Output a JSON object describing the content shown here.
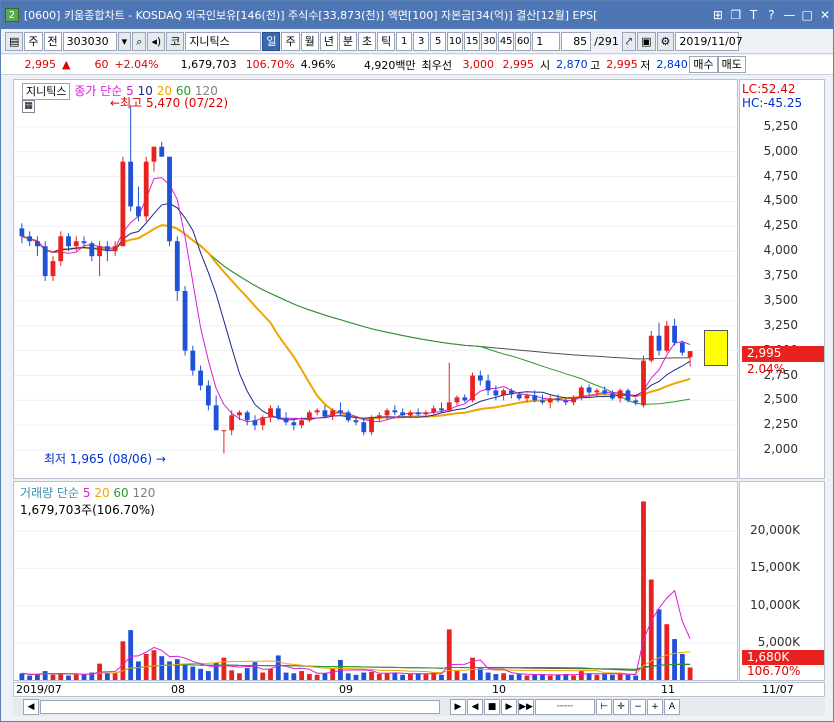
{
  "window": {
    "icon": "2",
    "title": "[0600] 키움종합차트 - KOSDAQ 외국인보유[146(천)] 주식수[33,873(천)] 액면[100] 자본금[34(억)] 결산[12월] EPS[",
    "controls": [
      "tile-icon",
      "restore-icon",
      "font-icon",
      "question-icon",
      "minimize-icon",
      "maximize-icon",
      "close-icon"
    ]
  },
  "toolbar": {
    "mode": "주",
    "period_select": "전",
    "code": "303030",
    "market": "코",
    "name": "지니틱스",
    "periods": [
      "일",
      "주",
      "월",
      "년",
      "분",
      "초",
      "틱"
    ],
    "active_period": "일",
    "minutes": [
      "1",
      "3",
      "5",
      "10",
      "15",
      "30",
      "45",
      "60"
    ],
    "count": "1",
    "page": "85",
    "total": "/291",
    "date": "2019/11/07"
  },
  "quote": {
    "price": "2,995",
    "change_arrow": "▲",
    "change": "60",
    "change_pct": "+2.04%",
    "volume": "1,679,703",
    "vol_ratio": "106.70%",
    "turnover": "4.96%",
    "amount": "4,920백만",
    "best_label": "최우선",
    "best_ask": "3,000",
    "best_bid": "2,995",
    "open_label": "시",
    "open": "2,870",
    "high_label": "고",
    "high": "2,995",
    "low_label": "저",
    "low": "2,840",
    "buy_label": "매수",
    "sell_label": "매도"
  },
  "price_panel": {
    "name_tag": "지니틱스",
    "legend_label": "종가 단순",
    "ma_periods": [
      "5",
      "10",
      "20",
      "60",
      "120"
    ],
    "high_note": "최고 5,470 (07/22)",
    "low_note": "최저 1,965 (08/06)",
    "lc": "LC:52.42",
    "hc": "HC:-45.25",
    "current_price": "2,995",
    "current_pct": "2.04%"
  },
  "volume_panel": {
    "legend_label": "거래량 단순",
    "ma_periods": [
      "5",
      "20",
      "60",
      "120"
    ],
    "current_volume": "1,679,703주(106.70%)",
    "current_tag": "1,680K",
    "current_pct": "106.70%"
  },
  "x_axis": {
    "labels": [
      "2019/07",
      "08",
      "09",
      "10",
      "11"
    ],
    "end_date": "11/07"
  },
  "colors": {
    "up": "#e8231f",
    "down": "#1f52d6",
    "ma5": "#d81fd8",
    "ma10": "#1a2a8a",
    "ma20": "#f0a400",
    "ma60": "#2a9a2a",
    "ma120": "#505050"
  },
  "chart_data": [
    {
      "type": "candlestick",
      "title": "지니틱스",
      "ylim": [
        1800,
        5500
      ],
      "yticks": [
        2000,
        2250,
        2500,
        2750,
        3000,
        3250,
        3500,
        3750,
        4000,
        4250,
        4500,
        4750,
        5000,
        5250
      ],
      "ytick_labels": [
        "2,000",
        "2,250",
        "2,500",
        "2,750",
        "3,000",
        "3,250",
        "3,500",
        "3,750",
        "4,000",
        "4,250",
        "4,500",
        "4,750",
        "5,000",
        "5,250"
      ],
      "ohlc": [
        [
          4230,
          4280,
          4080,
          4150
        ],
        [
          4150,
          4200,
          4050,
          4100
        ],
        [
          4100,
          4150,
          3950,
          4050
        ],
        [
          4050,
          4100,
          3700,
          3750
        ],
        [
          3750,
          3950,
          3700,
          3900
        ],
        [
          3900,
          4200,
          3850,
          4150
        ],
        [
          4150,
          4180,
          4000,
          4050
        ],
        [
          4050,
          4150,
          4000,
          4100
        ],
        [
          4100,
          4150,
          4050,
          4080
        ],
        [
          4080,
          4100,
          3900,
          3950
        ],
        [
          3950,
          4100,
          3750,
          4050
        ],
        [
          4050,
          4100,
          3900,
          4000
        ],
        [
          4000,
          4100,
          3950,
          4050
        ],
        [
          4050,
          4950,
          4050,
          4900
        ],
        [
          4900,
          5470,
          4400,
          4450
        ],
        [
          4450,
          4650,
          4300,
          4350
        ],
        [
          4350,
          4950,
          4300,
          4900
        ],
        [
          4900,
          5050,
          4800,
          5050
        ],
        [
          5050,
          5100,
          4950,
          4950
        ],
        [
          4950,
          4550,
          4050,
          4100
        ],
        [
          4100,
          4150,
          3500,
          3600
        ],
        [
          3600,
          3650,
          2950,
          3000
        ],
        [
          3000,
          3050,
          2750,
          2800
        ],
        [
          2800,
          2850,
          2600,
          2650
        ],
        [
          2650,
          2700,
          2400,
          2450
        ],
        [
          2450,
          2550,
          2200,
          2200
        ],
        [
          2200,
          2200,
          1965,
          2200
        ],
        [
          2200,
          2400,
          2150,
          2350
        ],
        [
          2350,
          2400,
          2300,
          2380
        ],
        [
          2380,
          2400,
          2250,
          2300
        ],
        [
          2300,
          2350,
          2200,
          2250
        ],
        [
          2250,
          2350,
          2200,
          2330
        ],
        [
          2330,
          2450,
          2280,
          2420
        ],
        [
          2420,
          2450,
          2300,
          2320
        ],
        [
          2320,
          2380,
          2250,
          2280
        ],
        [
          2280,
          2320,
          2200,
          2250
        ],
        [
          2250,
          2330,
          2220,
          2300
        ],
        [
          2300,
          2400,
          2280,
          2380
        ],
        [
          2380,
          2420,
          2350,
          2400
        ],
        [
          2400,
          2450,
          2320,
          2340
        ],
        [
          2340,
          2420,
          2300,
          2400
        ],
        [
          2400,
          2480,
          2350,
          2380
        ],
        [
          2380,
          2400,
          2280,
          2300
        ],
        [
          2300,
          2330,
          2250,
          2280
        ],
        [
          2280,
          2320,
          2150,
          2180
        ],
        [
          2180,
          2350,
          2150,
          2320
        ],
        [
          2320,
          2380,
          2280,
          2350
        ],
        [
          2350,
          2420,
          2300,
          2400
        ],
        [
          2400,
          2450,
          2350,
          2380
        ],
        [
          2380,
          2420,
          2330,
          2350
        ],
        [
          2350,
          2400,
          2320,
          2380
        ],
        [
          2380,
          2420,
          2340,
          2360
        ],
        [
          2360,
          2400,
          2330,
          2380
        ],
        [
          2380,
          2450,
          2350,
          2420
        ],
        [
          2420,
          2480,
          2380,
          2400
        ],
        [
          2400,
          2880,
          2380,
          2480
        ],
        [
          2480,
          2550,
          2450,
          2530
        ],
        [
          2530,
          2560,
          2480,
          2500
        ],
        [
          2500,
          2780,
          2480,
          2750
        ],
        [
          2750,
          2800,
          2650,
          2700
        ],
        [
          2700,
          2760,
          2550,
          2600
        ],
        [
          2600,
          2650,
          2500,
          2550
        ],
        [
          2550,
          2620,
          2500,
          2600
        ],
        [
          2600,
          2620,
          2520,
          2560
        ],
        [
          2560,
          2580,
          2500,
          2520
        ],
        [
          2520,
          2570,
          2480,
          2550
        ],
        [
          2550,
          2600,
          2480,
          2500
        ],
        [
          2500,
          2560,
          2460,
          2480
        ],
        [
          2480,
          2550,
          2420,
          2520
        ],
        [
          2520,
          2560,
          2480,
          2500
        ],
        [
          2500,
          2530,
          2450,
          2480
        ],
        [
          2480,
          2550,
          2450,
          2530
        ],
        [
          2530,
          2650,
          2500,
          2630
        ],
        [
          2630,
          2660,
          2550,
          2580
        ],
        [
          2580,
          2620,
          2540,
          2600
        ],
        [
          2600,
          2640,
          2550,
          2570
        ],
        [
          2570,
          2600,
          2500,
          2520
        ],
        [
          2520,
          2620,
          2480,
          2600
        ],
        [
          2600,
          2620,
          2480,
          2500
        ],
        [
          2500,
          2520,
          2450,
          2480
        ],
        [
          2450,
          2950,
          2430,
          2900
        ],
        [
          2900,
          3200,
          2880,
          3150
        ],
        [
          3150,
          3280,
          2950,
          3000
        ],
        [
          3000,
          3300,
          2980,
          3250
        ],
        [
          3250,
          3320,
          3050,
          3080
        ],
        [
          3080,
          3100,
          2950,
          2980
        ],
        [
          2935,
          2995,
          2840,
          2995
        ]
      ]
    },
    {
      "type": "bar",
      "title": "거래량",
      "ylim": [
        0,
        25000
      ],
      "yticks": [
        5000,
        10000,
        15000,
        20000
      ],
      "ytick_labels": [
        "5,000K",
        "10,000K",
        "15,000K",
        "20,000K"
      ],
      "values_k": [
        900,
        600,
        800,
        1200,
        700,
        900,
        600,
        800,
        700,
        1000,
        2200,
        900,
        900,
        5200,
        6700,
        2500,
        3500,
        4000,
        3200,
        2500,
        2800,
        2200,
        1800,
        1500,
        1200,
        2300,
        3000,
        1300,
        900,
        1600,
        2400,
        1000,
        1500,
        3300,
        1000,
        900,
        1200,
        800,
        700,
        900,
        1500,
        2700,
        900,
        700,
        1000,
        1100,
        800,
        900,
        1000,
        700,
        800,
        900,
        800,
        1000,
        700,
        6800,
        1200,
        900,
        3000,
        1600,
        1000,
        800,
        900,
        700,
        800,
        600,
        700,
        800,
        600,
        700,
        800,
        600,
        1200,
        900,
        700,
        800,
        700,
        900,
        700,
        600,
        24000,
        13500,
        9500,
        7500,
        5500,
        3500,
        1680
      ]
    }
  ]
}
